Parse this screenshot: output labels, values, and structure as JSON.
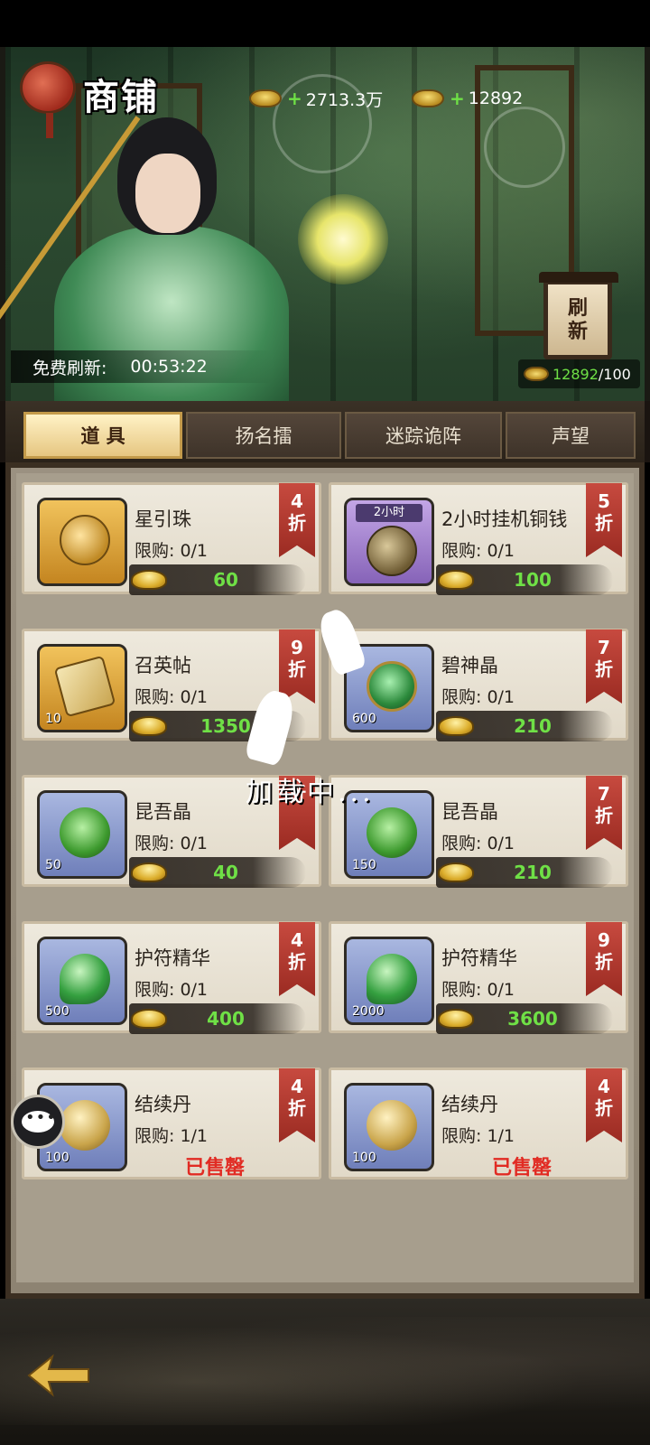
{
  "header": {
    "title": "商铺",
    "copper": "2713.3万",
    "gold": "12892",
    "free_refresh_label": "免费刷新:",
    "free_refresh_time": "00:53:22",
    "refresh_button_line1": "刷",
    "refresh_button_line2": "新",
    "refresh_have": "12892",
    "refresh_cost": "/100"
  },
  "tabs": [
    {
      "label": "道 具",
      "active": true
    },
    {
      "label": "扬名擂",
      "active": false
    },
    {
      "label": "迷踪诡阵",
      "active": false
    },
    {
      "label": "声望",
      "active": false
    }
  ],
  "items": [
    {
      "name": "星引珠",
      "limit": "限购: 0/1",
      "price": "60",
      "discount_num": "4",
      "discount_word": "折",
      "icon": "star-orb-icon",
      "qty": "",
      "sold_out": ""
    },
    {
      "name": "2小时挂机铜钱",
      "limit": "限购: 0/1",
      "price": "100",
      "discount_num": "5",
      "discount_word": "折",
      "icon": "copper-coins-icon",
      "qty": "",
      "tag": "2小时",
      "sold_out": ""
    },
    {
      "name": "召英帖",
      "limit": "限购: 0/1",
      "price": "1350",
      "discount_num": "9",
      "discount_word": "折",
      "icon": "scroll-icon",
      "qty": "10",
      "sold_out": ""
    },
    {
      "name": "碧神晶",
      "limit": "限购: 0/1",
      "price": "210",
      "discount_num": "7",
      "discount_word": "折",
      "icon": "jade-crystal-icon",
      "qty": "600",
      "sold_out": ""
    },
    {
      "name": "昆吾晶",
      "limit": "限购: 0/1",
      "price": "40",
      "discount_num": "",
      "discount_word": "折",
      "icon": "green-crystal-icon",
      "qty": "50",
      "sold_out": ""
    },
    {
      "name": "昆吾晶",
      "limit": "限购: 0/1",
      "price": "210",
      "discount_num": "7",
      "discount_word": "折",
      "icon": "green-crystal-icon",
      "qty": "150",
      "sold_out": ""
    },
    {
      "name": "护符精华",
      "limit": "限购: 0/1",
      "price": "400",
      "discount_num": "4",
      "discount_word": "折",
      "icon": "amulet-essence-icon",
      "qty": "500",
      "sold_out": ""
    },
    {
      "name": "护符精华",
      "limit": "限购: 0/1",
      "price": "3600",
      "discount_num": "9",
      "discount_word": "折",
      "icon": "amulet-essence-icon",
      "qty": "2000",
      "sold_out": ""
    },
    {
      "name": "结续丹",
      "limit": "限购: 1/1",
      "price": "",
      "discount_num": "4",
      "discount_word": "折",
      "icon": "golden-pill-icon",
      "qty": "100",
      "sold_out": "已售罄"
    },
    {
      "name": "结续丹",
      "limit": "限购: 1/1",
      "price": "",
      "discount_num": "4",
      "discount_word": "折",
      "icon": "golden-pill-icon",
      "qty": "100",
      "sold_out": "已售罄"
    }
  ],
  "loading_text": "加载中...",
  "colors": {
    "price_green": "#6fe046",
    "sold_out_red": "#e12b23",
    "discount_red": "#b5372d",
    "active_tab": "#f3dfa3"
  }
}
